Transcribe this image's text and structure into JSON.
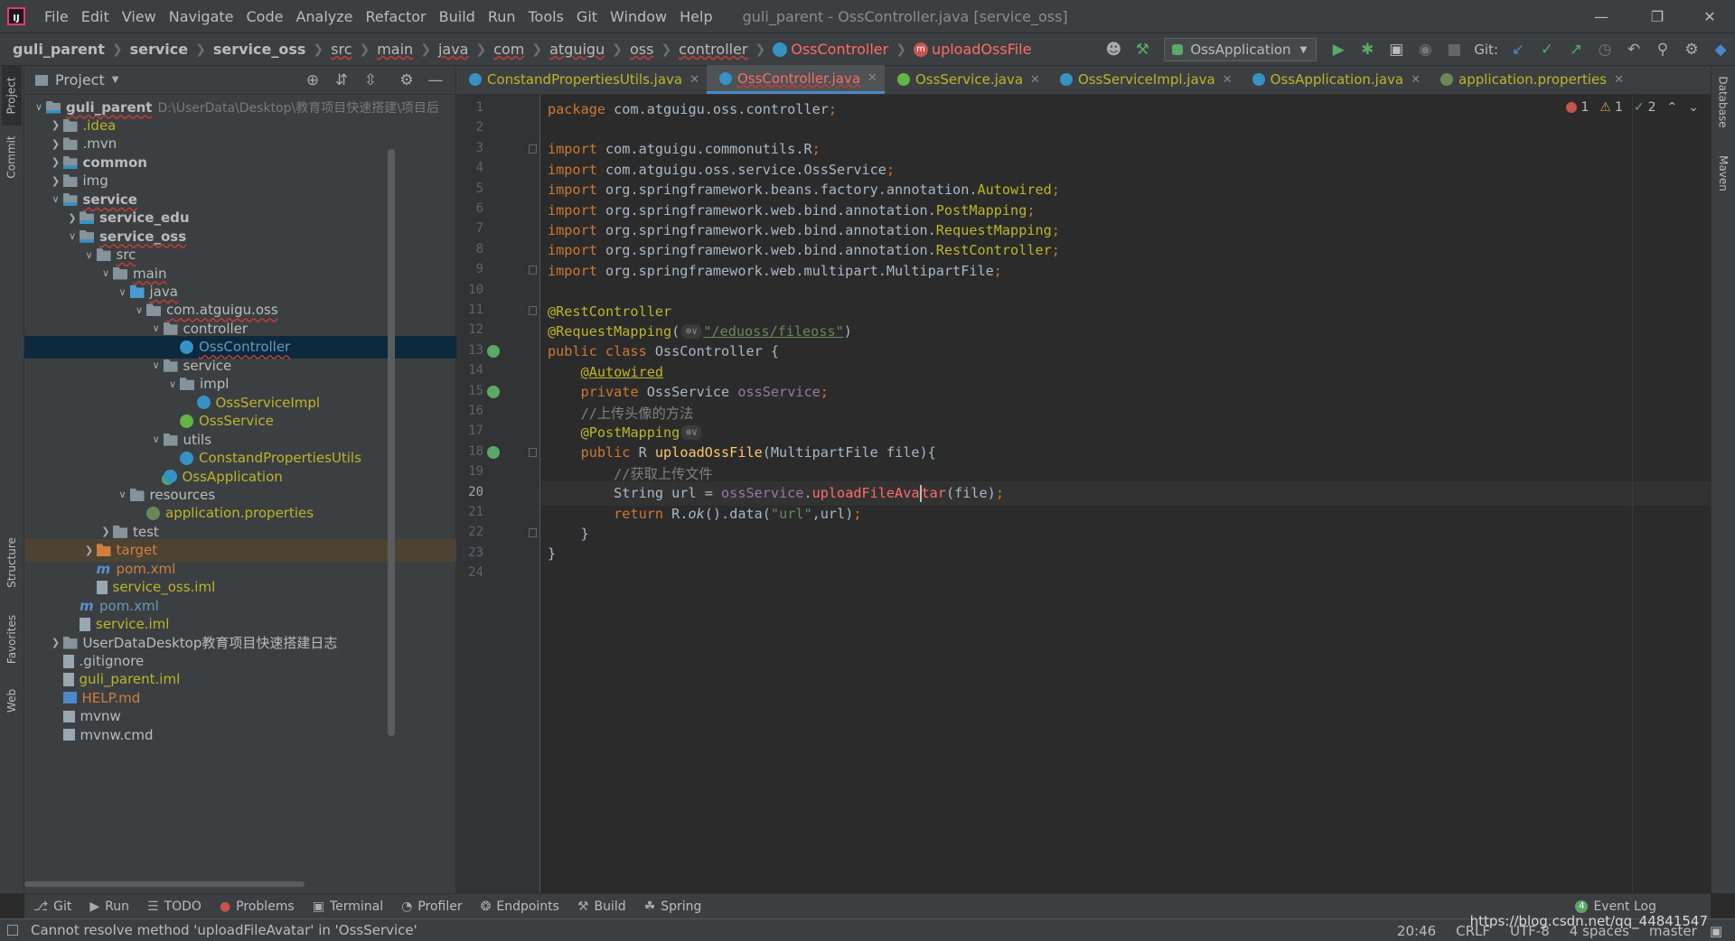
{
  "window": {
    "title": "guli_parent - OssController.java [service_oss]",
    "menu": [
      "File",
      "Edit",
      "View",
      "Navigate",
      "Code",
      "Analyze",
      "Refactor",
      "Build",
      "Run",
      "Tools",
      "Git",
      "Window",
      "Help"
    ]
  },
  "navbar": {
    "breadcrumbs": [
      "guli_parent",
      "service",
      "service_oss",
      "src",
      "main",
      "java",
      "com",
      "atguigu",
      "oss",
      "controller",
      "OssController",
      "uploadOssFile"
    ],
    "run_config": "OssApplication",
    "git_label": "Git:"
  },
  "left_stripe": {
    "tabs": [
      "Project",
      "Commit",
      "Structure",
      "Favorites",
      "Web"
    ]
  },
  "right_stripe": {
    "tabs": [
      "Database",
      "Maven"
    ]
  },
  "project": {
    "header": "Project",
    "tree": [
      {
        "label": "guli_parent",
        "path": "D:\\UserData\\Desktop\\教育项目快速搭建\\项目后",
        "depth": 0,
        "icon": "module-folder-icon",
        "arrow": "down",
        "bold": true,
        "style": "err"
      },
      {
        "label": ".idea",
        "depth": 1,
        "icon": "folder-icon",
        "arrow": "right",
        "style": "yellow"
      },
      {
        "label": ".mvn",
        "depth": 1,
        "icon": "folder-icon",
        "arrow": "right"
      },
      {
        "label": "common",
        "depth": 1,
        "icon": "module-folder-icon",
        "arrow": "right",
        "bold": true
      },
      {
        "label": "img",
        "depth": 1,
        "icon": "folder-icon",
        "arrow": "right"
      },
      {
        "label": "service",
        "depth": 1,
        "icon": "module-folder-icon",
        "arrow": "down",
        "bold": true,
        "style": "err"
      },
      {
        "label": "service_edu",
        "depth": 2,
        "icon": "module-folder-icon",
        "arrow": "right",
        "bold": true
      },
      {
        "label": "service_oss",
        "depth": 2,
        "icon": "module-folder-icon",
        "arrow": "down",
        "bold": true,
        "style": "err"
      },
      {
        "label": "src",
        "depth": 3,
        "icon": "folder-icon",
        "arrow": "down",
        "style": "err"
      },
      {
        "label": "main",
        "depth": 4,
        "icon": "folder-icon",
        "arrow": "down",
        "style": "err"
      },
      {
        "label": "java",
        "depth": 5,
        "icon": "source-folder-icon",
        "arrow": "down",
        "style": "err"
      },
      {
        "label": "com.atguigu.oss",
        "depth": 6,
        "icon": "package-icon",
        "arrow": "down",
        "style": "err"
      },
      {
        "label": "controller",
        "depth": 7,
        "icon": "package-icon",
        "arrow": "down",
        "style": "err"
      },
      {
        "label": "OssController",
        "depth": 8,
        "icon": "class-icon",
        "arrow": "",
        "style": "err-blue",
        "selected": true
      },
      {
        "label": "service",
        "depth": 7,
        "icon": "package-icon",
        "arrow": "down"
      },
      {
        "label": "impl",
        "depth": 8,
        "icon": "package-icon",
        "arrow": "down"
      },
      {
        "label": "OssServiceImpl",
        "depth": 9,
        "icon": "class-icon",
        "arrow": "",
        "style": "yellow"
      },
      {
        "label": "OssService",
        "depth": 8,
        "icon": "interface-icon",
        "arrow": "",
        "style": "yellow"
      },
      {
        "label": "utils",
        "depth": 7,
        "icon": "package-icon",
        "arrow": "down"
      },
      {
        "label": "ConstandPropertiesUtils",
        "depth": 8,
        "icon": "class-icon",
        "arrow": "",
        "style": "yellow"
      },
      {
        "label": "OssApplication",
        "depth": 7,
        "icon": "spring-app-icon",
        "arrow": "",
        "style": "yellow"
      },
      {
        "label": "resources",
        "depth": 5,
        "icon": "resources-folder-icon",
        "arrow": "down"
      },
      {
        "label": "application.properties",
        "depth": 6,
        "icon": "properties-icon",
        "arrow": "",
        "style": "yellow"
      },
      {
        "label": "test",
        "depth": 4,
        "icon": "folder-icon",
        "arrow": "right"
      },
      {
        "label": "target",
        "depth": 3,
        "icon": "excluded-folder-icon",
        "arrow": "right",
        "style": "orange",
        "excluded": true
      },
      {
        "label": "pom.xml",
        "depth": 3,
        "icon": "maven-icon",
        "arrow": "",
        "style": "orange"
      },
      {
        "label": "service_oss.iml",
        "depth": 3,
        "icon": "file-icon",
        "arrow": "",
        "style": "yellow"
      },
      {
        "label": "pom.xml",
        "depth": 2,
        "icon": "maven-icon",
        "arrow": "",
        "style": "blue"
      },
      {
        "label": "service.iml",
        "depth": 2,
        "icon": "file-icon",
        "arrow": "",
        "style": "yellow"
      },
      {
        "label": "UserDataDesktop教育项目快速搭建日志",
        "depth": 1,
        "icon": "folder-icon",
        "arrow": "right"
      },
      {
        "label": ".gitignore",
        "depth": 1,
        "icon": "file-icon",
        "arrow": ""
      },
      {
        "label": "guli_parent.iml",
        "depth": 1,
        "icon": "file-icon",
        "arrow": "",
        "style": "yellow"
      },
      {
        "label": "HELP.md",
        "depth": 1,
        "icon": "markdown-icon",
        "arrow": "",
        "style": "orange"
      },
      {
        "label": "mvnw",
        "depth": 1,
        "icon": "exec-file-icon",
        "arrow": ""
      },
      {
        "label": "mvnw.cmd",
        "depth": 1,
        "icon": "exec-file-icon",
        "arrow": ""
      }
    ]
  },
  "editor": {
    "tabs": [
      {
        "name": "ConstandPropertiesUtils.java",
        "icon_color": "#3592c4"
      },
      {
        "name": "OssController.java",
        "icon_color": "#3592c4",
        "active": true,
        "error": true
      },
      {
        "name": "OssService.java",
        "icon_color": "#62b543"
      },
      {
        "name": "OssServiceImpl.java",
        "icon_color": "#3592c4"
      },
      {
        "name": "OssApplication.java",
        "icon_color": "#3592c4"
      },
      {
        "name": "application.properties",
        "icon_color": "#6a8759"
      }
    ],
    "inspections": {
      "errors": "1",
      "warnings": "1",
      "ok": "2"
    },
    "current_line": 20,
    "lines": [
      [
        {
          "t": "package ",
          "c": "kw"
        },
        {
          "t": "com.atguigu.oss.controller"
        },
        {
          "t": ";",
          "c": "kw"
        }
      ],
      [],
      [
        {
          "t": "import ",
          "c": "kw"
        },
        {
          "t": "com.atguigu.commonutils.R"
        },
        {
          "t": ";",
          "c": "kw"
        }
      ],
      [
        {
          "t": "import ",
          "c": "kw"
        },
        {
          "t": "com.atguigu.oss.service.OssService"
        },
        {
          "t": ";",
          "c": "kw"
        }
      ],
      [
        {
          "t": "import ",
          "c": "kw"
        },
        {
          "t": "org.springframework.beans.factory.annotation."
        },
        {
          "t": "Autowired",
          "c": "ann"
        },
        {
          "t": ";",
          "c": "kw"
        }
      ],
      [
        {
          "t": "import ",
          "c": "kw"
        },
        {
          "t": "org.springframework.web.bind.annotation."
        },
        {
          "t": "PostMapping",
          "c": "ann"
        },
        {
          "t": ";",
          "c": "kw"
        }
      ],
      [
        {
          "t": "import ",
          "c": "kw"
        },
        {
          "t": "org.springframework.web.bind.annotation."
        },
        {
          "t": "RequestMapping",
          "c": "ann"
        },
        {
          "t": ";",
          "c": "kw"
        }
      ],
      [
        {
          "t": "import ",
          "c": "kw"
        },
        {
          "t": "org.springframework.web.bind.annotation."
        },
        {
          "t": "RestController",
          "c": "ann"
        },
        {
          "t": ";",
          "c": "kw"
        }
      ],
      [
        {
          "t": "import ",
          "c": "kw"
        },
        {
          "t": "org.springframework.web.multipart.MultipartFile"
        },
        {
          "t": ";",
          "c": "kw"
        }
      ],
      [],
      [
        {
          "t": "@RestController",
          "c": "ann"
        }
      ],
      [
        {
          "t": "@RequestMapping",
          "c": "ann"
        },
        {
          "t": "("
        },
        {
          "inlay": "⊕∨"
        },
        {
          "t": "\"/eduoss/fileoss\"",
          "c": "str underline"
        },
        {
          "t": ")"
        }
      ],
      [
        {
          "t": "public class ",
          "c": "kw"
        },
        {
          "t": "OssController {"
        }
      ],
      [
        {
          "t": "    "
        },
        {
          "t": "@Autowired",
          "c": "ann underline"
        }
      ],
      [
        {
          "t": "    "
        },
        {
          "t": "private ",
          "c": "kw"
        },
        {
          "t": "OssService "
        },
        {
          "t": "ossService",
          "c": "field"
        },
        {
          "t": ";",
          "c": "kw"
        }
      ],
      [
        {
          "t": "    "
        },
        {
          "t": "//上传头像的方法",
          "c": "comment"
        }
      ],
      [
        {
          "t": "    "
        },
        {
          "t": "@PostMapping",
          "c": "ann"
        },
        {
          "inlay": "⊕∨"
        }
      ],
      [
        {
          "t": "    "
        },
        {
          "t": "public ",
          "c": "kw"
        },
        {
          "t": "R "
        },
        {
          "t": "uploadOssFile",
          "c": "method"
        },
        {
          "t": "(MultipartFile file){"
        }
      ],
      [
        {
          "t": "        "
        },
        {
          "t": "//获取上传文件",
          "c": "comment"
        }
      ],
      [
        {
          "t": "        "
        },
        {
          "t": "String url = "
        },
        {
          "t": "ossService",
          "c": "field"
        },
        {
          "t": "."
        },
        {
          "t": "uploadFileAva",
          "c": "errtxt"
        },
        {
          "caret": true
        },
        {
          "t": "tar",
          "c": "errtxt"
        },
        {
          "t": "(file)"
        },
        {
          "t": ";",
          "c": "kw"
        }
      ],
      [
        {
          "t": "        "
        },
        {
          "t": "return ",
          "c": "kw"
        },
        {
          "t": "R."
        },
        {
          "t": "ok",
          "c": "ital"
        },
        {
          "t": "().data("
        },
        {
          "t": "\"url\"",
          "c": "str"
        },
        {
          "t": ",url)"
        },
        {
          "t": ";",
          "c": "kw"
        }
      ],
      [
        {
          "t": "    }"
        }
      ],
      [
        {
          "t": "}"
        }
      ],
      []
    ]
  },
  "bottom_tools": [
    {
      "label": "Git",
      "icon": "git-icon"
    },
    {
      "label": "Run",
      "icon": "run-icon"
    },
    {
      "label": "TODO",
      "icon": "todo-icon"
    },
    {
      "label": "Problems",
      "icon": "problems-icon"
    },
    {
      "label": "Terminal",
      "icon": "terminal-icon"
    },
    {
      "label": "Profiler",
      "icon": "profiler-icon"
    },
    {
      "label": "Endpoints",
      "icon": "endpoints-icon"
    },
    {
      "label": "Build",
      "icon": "build-icon"
    },
    {
      "label": "Spring",
      "icon": "spring-icon"
    }
  ],
  "event_log": {
    "count": "4",
    "label": "Event Log"
  },
  "status": {
    "message": "Cannot resolve method 'uploadFileAvatar' in 'OssService'",
    "position": "20:46",
    "line_sep": "CRLF",
    "encoding": "UTF-8",
    "indent": "4 spaces",
    "branch": "master",
    "watermark": "https://blog.csdn.net/qq_44841547"
  }
}
